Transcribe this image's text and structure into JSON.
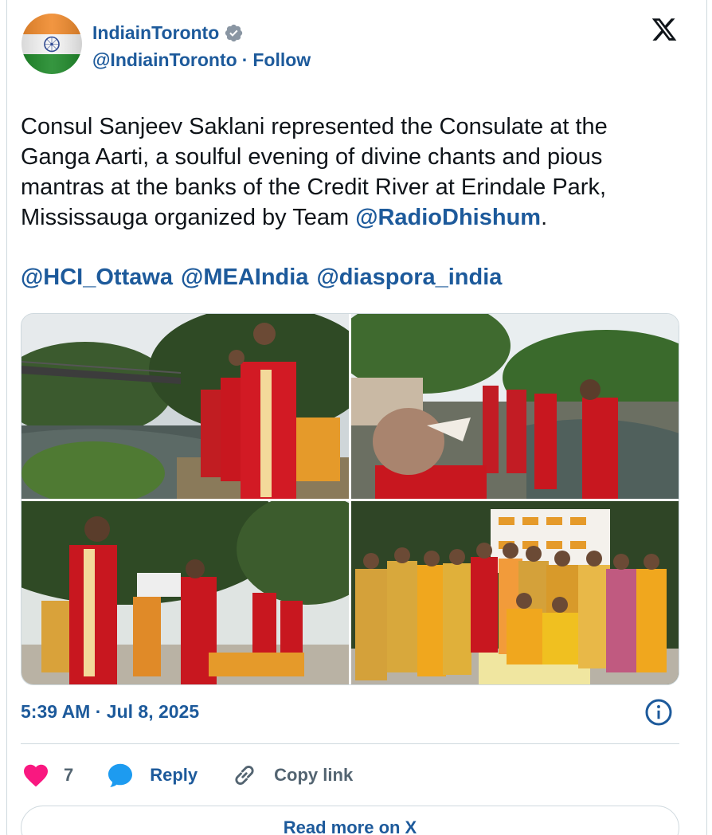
{
  "author": {
    "display_name": "IndiainToronto",
    "handle": "@IndiainToronto",
    "separator": "·",
    "follow_label": "Follow"
  },
  "tweet": {
    "text_before": "Consul Sanjeev Saklani represented the Consulate at the Ganga Aarti, a soulful evening of divine chants and pious mantras at the banks of the Credit River at Erindale Park, Mississauga organized by Team ",
    "mention": "@RadioDhishum",
    "text_after": ".",
    "tags": [
      "@HCI_Ottawa",
      "@MEAIndia",
      "@diaspora_india"
    ]
  },
  "timestamp": "5:39 AM · Jul 8, 2025",
  "actions": {
    "like_count": "7",
    "reply_label": "Reply",
    "copy_label": "Copy link"
  },
  "read_more_label": "Read more on X",
  "icons": {
    "verified": "verified-badge-icon",
    "platform": "x-logo-icon",
    "info": "info-icon",
    "like": "heart-icon",
    "reply": "reply-bubble-icon",
    "copy": "link-icon"
  },
  "colors": {
    "link": "#1d5a9b",
    "like": "#f91880",
    "border": "#cfd9de",
    "muted": "#536471"
  }
}
